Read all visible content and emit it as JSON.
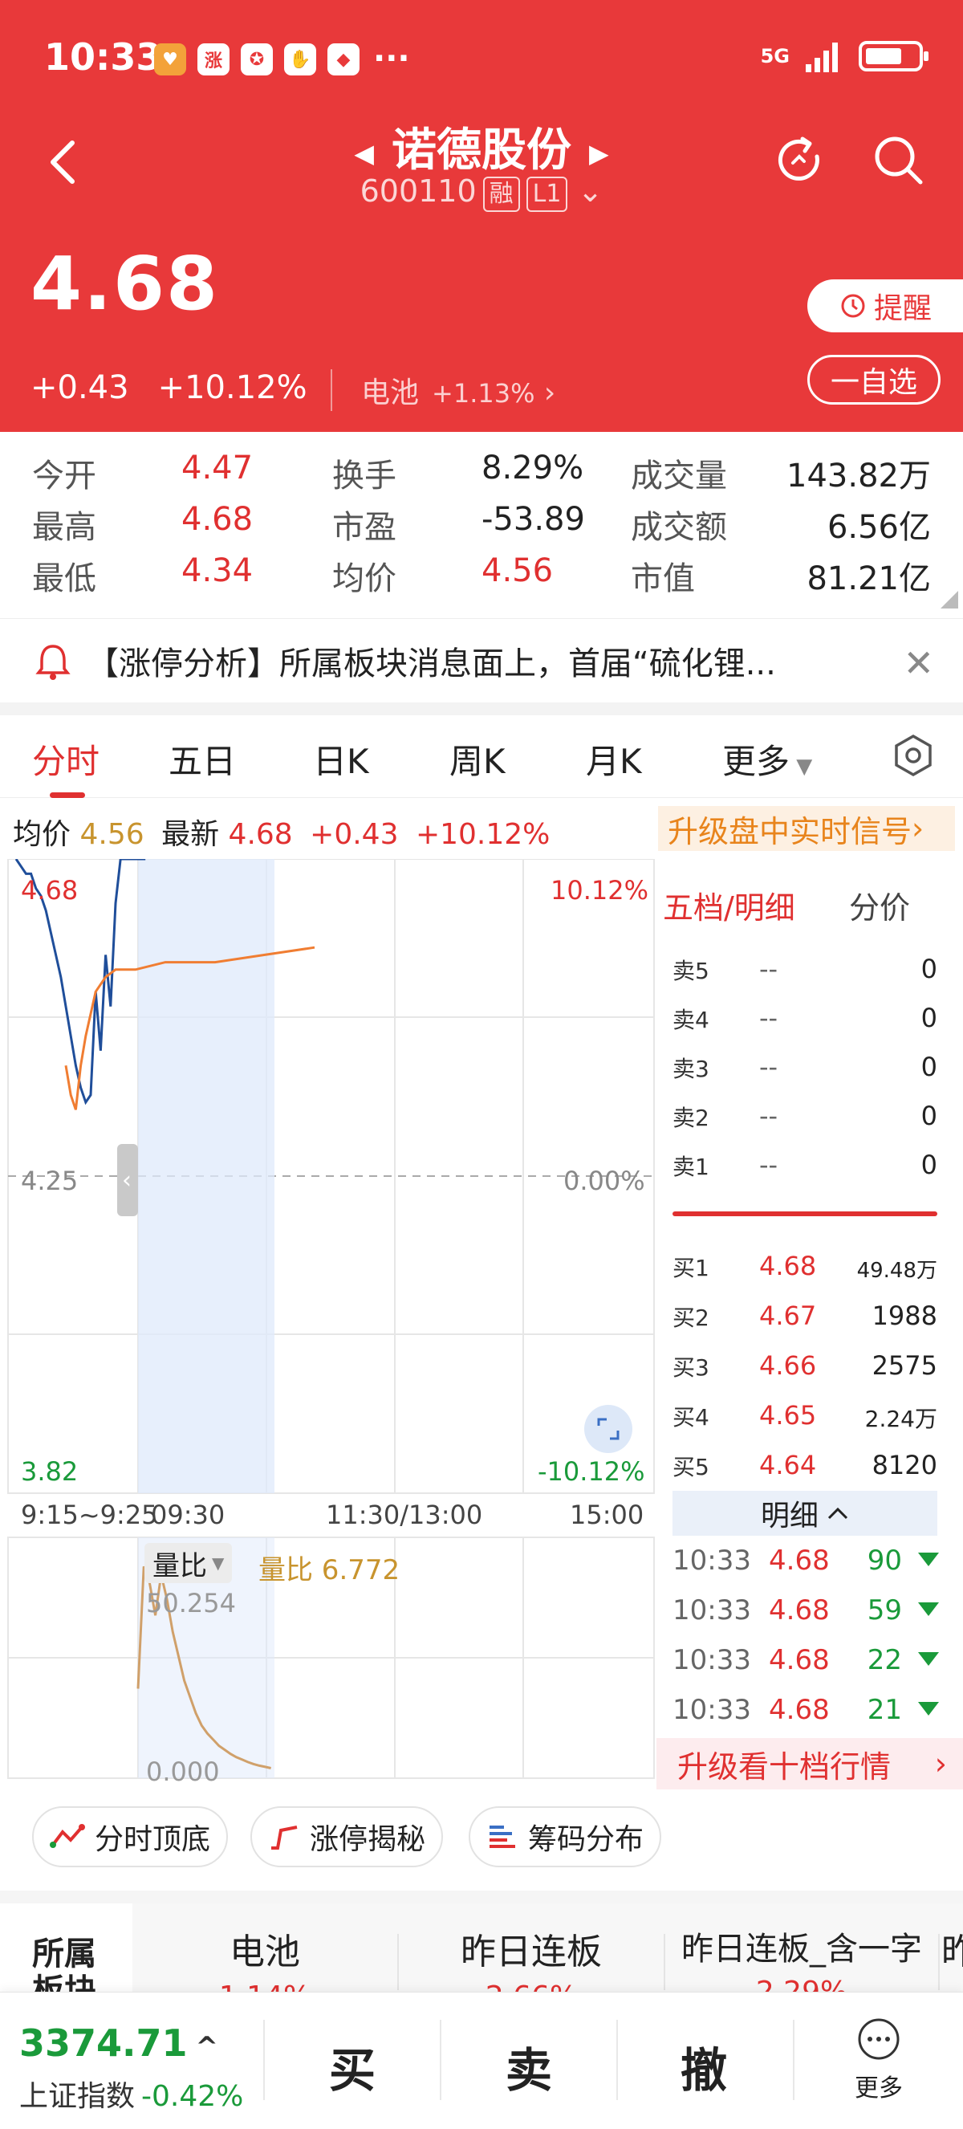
{
  "status_bar": {
    "time": "10:33",
    "icons": [
      "heart-shield-icon",
      "limit-up-icon",
      "fund-icon",
      "hand-icon",
      "bank-icon"
    ],
    "more": "···",
    "network": "5G"
  },
  "header": {
    "stock_name": "诺德股份",
    "stock_code": "600110",
    "tag_margin": "融",
    "tag_level": "L1",
    "price": "4.68",
    "change": "+0.43",
    "change_pct": "+10.12%",
    "sector_name": "电池",
    "sector_pct": "+1.13%",
    "remind_label": "提醒",
    "fav_label": "一自选",
    "colors": {
      "brand": "#e8393a",
      "up": "#e03030",
      "down": "#1a9a3a"
    }
  },
  "stats": [
    {
      "label": "今开",
      "value": "4.47"
    },
    {
      "label": "换手",
      "value": "8.29%"
    },
    {
      "label": "成交量",
      "value": "143.82万"
    },
    {
      "label": "最高",
      "value": "4.68"
    },
    {
      "label": "市盈",
      "value": "-53.89"
    },
    {
      "label": "成交额",
      "value": "6.56亿"
    },
    {
      "label": "最低",
      "value": "4.34"
    },
    {
      "label": "均价",
      "value": "4.56"
    },
    {
      "label": "市值",
      "value": "81.21亿"
    }
  ],
  "notice": {
    "text": "【涨停分析】所属板块消息面上，首届“硫化锂..."
  },
  "tabs": [
    "分时",
    "五日",
    "日K",
    "周K",
    "月K",
    "更多"
  ],
  "info_line": {
    "avg_label": "均价",
    "avg_value": "4.56",
    "latest_label": "最新",
    "latest_value": "4.68",
    "change": "+0.43",
    "change_pct": "+10.12%"
  },
  "upgrade_signal": "升级盘中实时信号",
  "chart_data": {
    "type": "line",
    "price_axis": {
      "top": "4.68",
      "mid": "4.25",
      "bottom": "3.82",
      "top_pct": "10.12%",
      "mid_pct": "0.00%",
      "bottom_pct": "-10.12%",
      "ylim": [
        3.82,
        4.68
      ]
    },
    "x_ticks": [
      "9:15~9:25",
      "09:30",
      "11:30/13:00",
      "15:00"
    ],
    "series": [
      {
        "color": "#1f4e9a",
        "x": [
          0,
          1,
          2,
          3,
          4,
          5,
          6,
          7,
          8,
          9,
          10,
          11,
          12,
          13,
          14,
          15,
          16,
          17,
          18,
          19,
          20,
          21,
          22,
          23,
          24,
          25,
          26
        ],
        "y": [
          4.68,
          4.67,
          4.66,
          4.66,
          4.64,
          4.63,
          4.61,
          4.58,
          4.55,
          4.52,
          4.48,
          4.44,
          4.4,
          4.37,
          4.35,
          4.36,
          4.5,
          4.42,
          4.55,
          4.48,
          4.62,
          4.68,
          4.68,
          4.68,
          4.68,
          4.68,
          4.68
        ]
      },
      {
        "color": "#f07d32",
        "x": [
          10,
          11,
          12,
          13,
          14,
          15,
          16,
          18,
          20,
          24,
          30,
          40,
          50,
          60
        ],
        "y": [
          4.4,
          4.36,
          4.34,
          4.4,
          4.44,
          4.47,
          4.5,
          4.52,
          4.53,
          4.53,
          4.54,
          4.54,
          4.55,
          4.56
        ]
      }
    ],
    "volume_ratio": {
      "label": "量比",
      "value_label": "量比 6.772",
      "max_label": "50.254",
      "min_label": "0.000",
      "y": [
        20,
        50,
        46,
        38,
        48,
        42,
        34,
        28,
        22,
        18,
        14,
        11,
        9,
        7.5,
        6,
        5,
        4,
        3.2,
        2.6,
        2,
        1.5,
        1.1,
        0.8,
        0.5
      ]
    }
  },
  "order_book": {
    "title": "五档/明细",
    "title2": "分价",
    "sells": [
      {
        "name": "卖5",
        "price": "--",
        "volume": "0"
      },
      {
        "name": "卖4",
        "price": "--",
        "volume": "0"
      },
      {
        "name": "卖3",
        "price": "--",
        "volume": "0"
      },
      {
        "name": "卖2",
        "price": "--",
        "volume": "0"
      },
      {
        "name": "卖1",
        "price": "--",
        "volume": "0"
      }
    ],
    "buys": [
      {
        "name": "买1",
        "price": "4.68",
        "volume": "49.48万"
      },
      {
        "name": "买2",
        "price": "4.67",
        "volume": "1988"
      },
      {
        "name": "买3",
        "price": "4.66",
        "volume": "2575"
      },
      {
        "name": "买4",
        "price": "4.65",
        "volume": "2.24万"
      },
      {
        "name": "买5",
        "price": "4.64",
        "volume": "8120"
      }
    ],
    "detail_label": "明细",
    "ticks": [
      {
        "time": "10:33",
        "price": "4.68",
        "volume": "90"
      },
      {
        "time": "10:33",
        "price": "4.68",
        "volume": "59"
      },
      {
        "time": "10:33",
        "price": "4.68",
        "volume": "22"
      },
      {
        "time": "10:33",
        "price": "4.68",
        "volume": "21"
      }
    ],
    "upgrade_ten": "升级看十档行情"
  },
  "tools": [
    "分时顶底",
    "涨停揭秘",
    "筹码分布"
  ],
  "sectors": {
    "left_label": "所属\n板块",
    "items": [
      {
        "name": "电池",
        "pct": "1.14%"
      },
      {
        "name": "昨日连板",
        "pct": "2.66%"
      },
      {
        "name": "昨日连板_含一字",
        "pct": "2.29%"
      },
      {
        "name": "昨",
        "pct": ""
      }
    ]
  },
  "bottom_bar": {
    "index_value": "3374.71",
    "index_name": "上证指数",
    "index_pct": "-0.42%",
    "buy": "买",
    "sell": "卖",
    "cancel": "撤",
    "more": "更多"
  }
}
